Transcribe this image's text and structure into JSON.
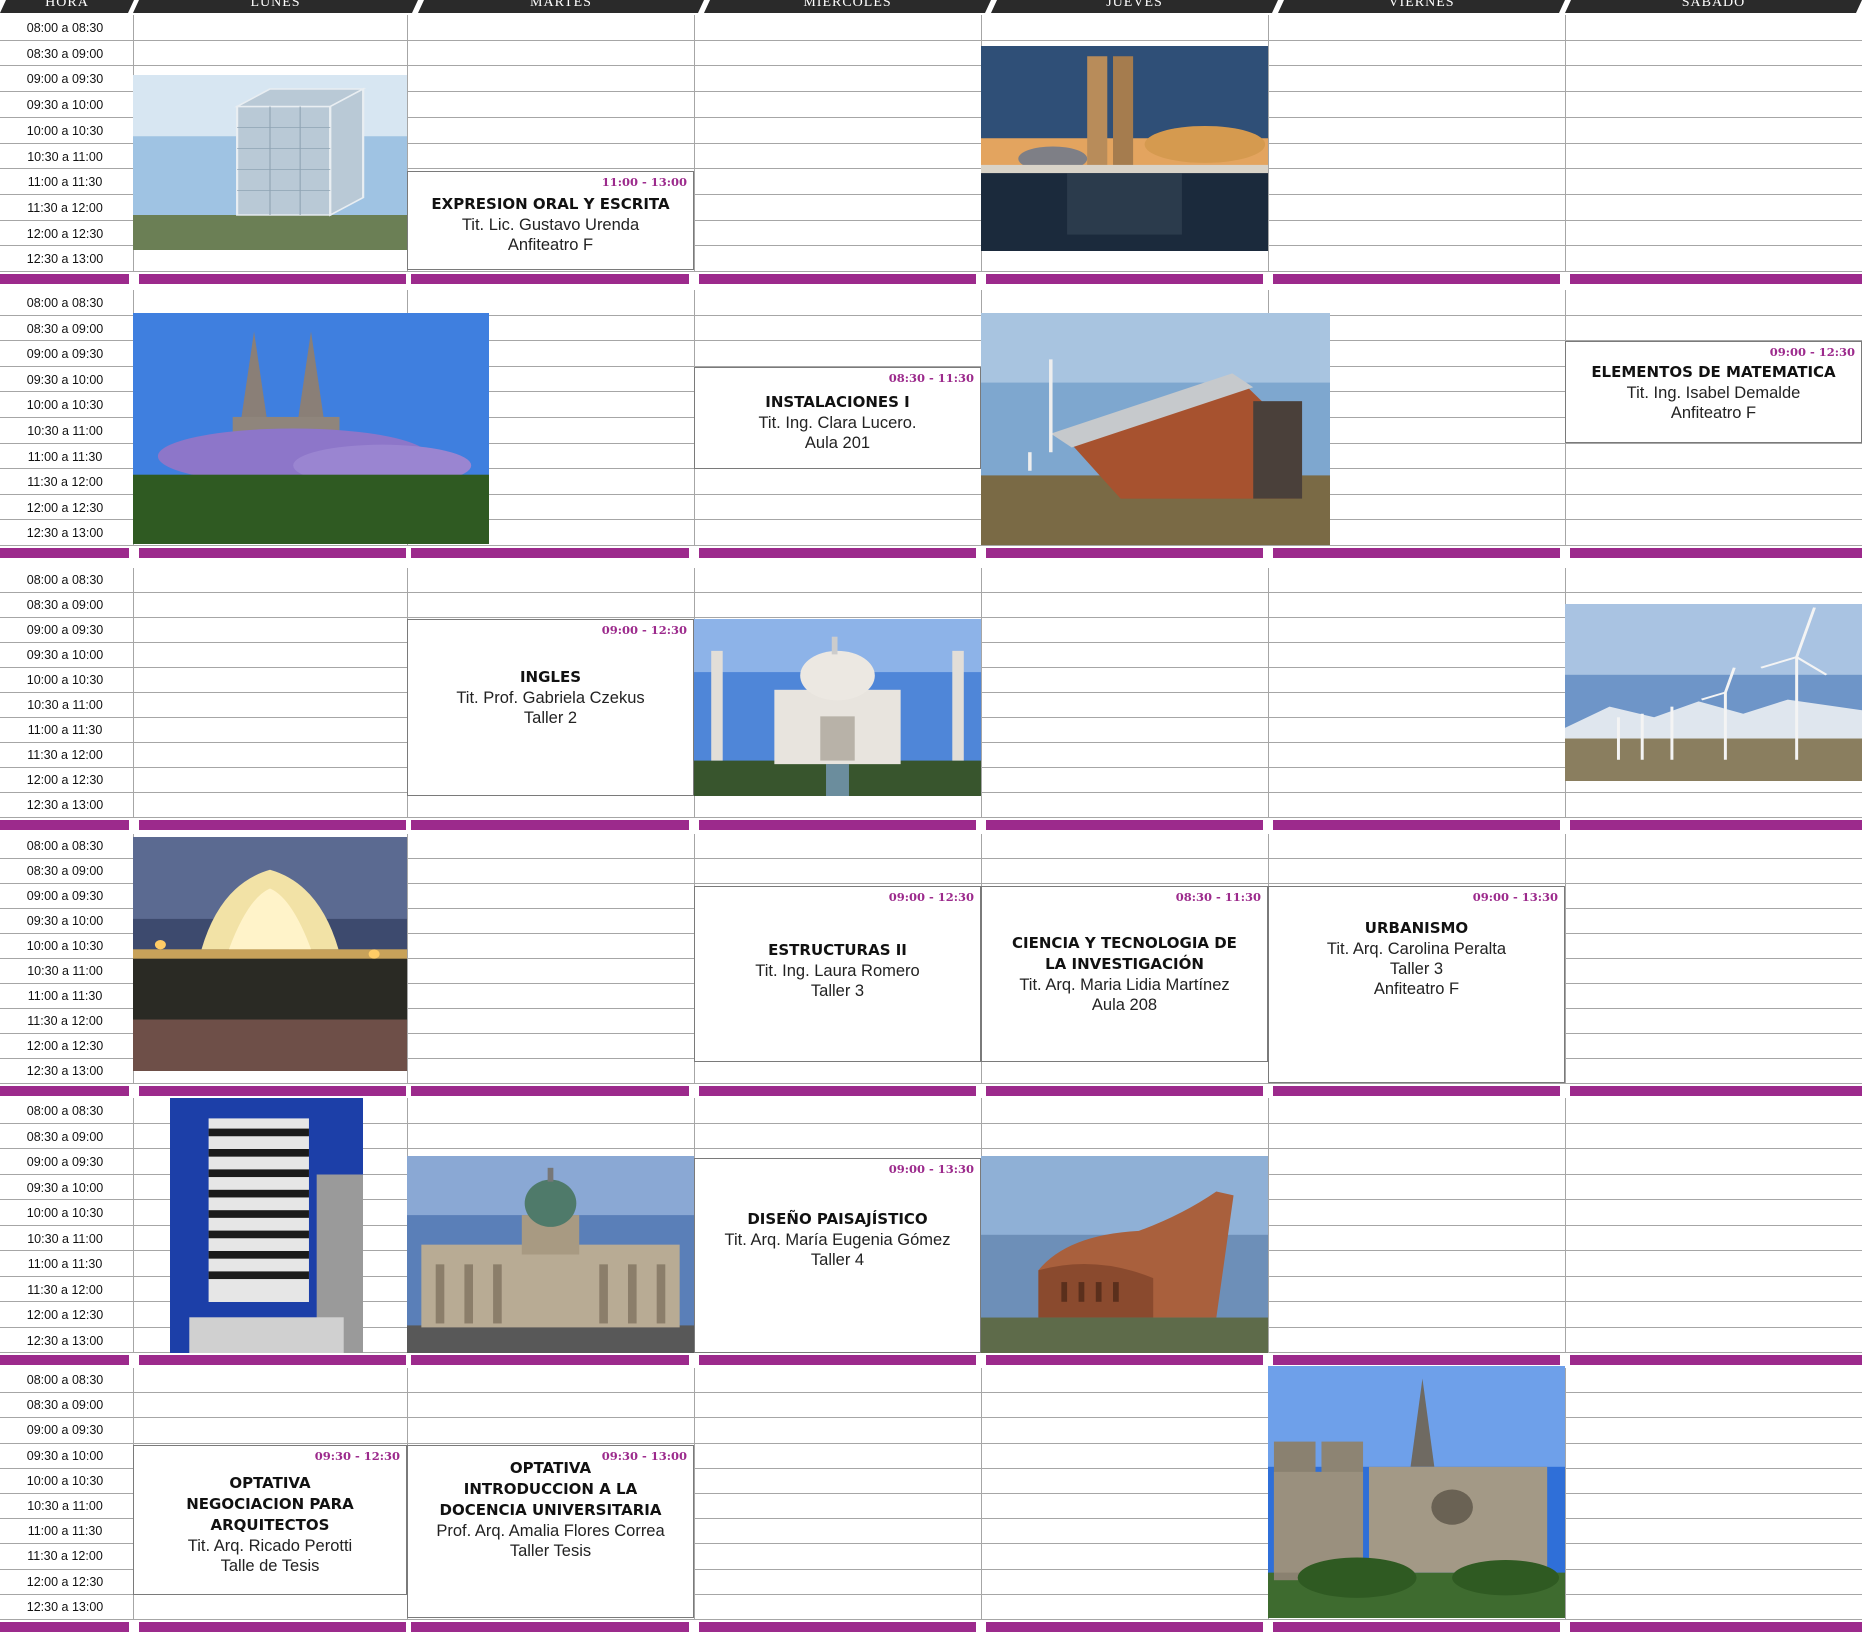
{
  "headers": [
    "HORA",
    "LUNES",
    "MARTES",
    "MIERCOLES",
    "JUEVES",
    "VIERNES",
    "SABADO"
  ],
  "times": [
    "08:00 a 08:30",
    "08:30 a 09:00",
    "09:00 a 09:30",
    "09:30 a 10:00",
    "10:00 a 10:30",
    "10:30 a 11:00",
    "11:00 a 11:30",
    "11:30 a 12:00",
    "12:00 a 12:30",
    "12:30 a 13:00"
  ],
  "colors": {
    "accent": "#9c2a8c",
    "header_bg": "#2a2a2a",
    "grid": "#a6a6a6"
  },
  "courses": [
    {
      "time": "11:00 - 13:00",
      "name": [
        "EXPRESION ORAL Y ESCRITA"
      ],
      "lines": [
        "Tit. Lic. Gustavo Urenda",
        "Anfiteatro F"
      ]
    },
    {
      "time": "08:30 - 11:30",
      "name": [
        "INSTALACIONES I"
      ],
      "lines": [
        "Tit. Ing. Clara Lucero.",
        "Aula 201"
      ]
    },
    {
      "time": "09:00 - 12:30",
      "name": [
        "ELEMENTOS DE MATEMATICA"
      ],
      "lines": [
        "Tit. Ing. Isabel Demalde",
        "Anfiteatro F"
      ]
    },
    {
      "time": "09:00 - 12:30",
      "name": [
        "INGLES"
      ],
      "lines": [
        "Tit. Prof. Gabriela Czekus",
        "Taller 2"
      ]
    },
    {
      "time": "09:00 - 12:30",
      "name": [
        "ESTRUCTURAS II"
      ],
      "lines": [
        "Tit. Ing. Laura Romero",
        "Taller 3"
      ]
    },
    {
      "time": "08:30 - 11:30",
      "name": [
        "CIENCIA Y TECNOLOGIA DE",
        "LA INVESTIGACIÓN"
      ],
      "lines": [
        "Tit. Arq. Maria Lidia Martínez",
        "Aula 208"
      ]
    },
    {
      "time": "09:00 - 13:30",
      "name": [
        "URBANISMO"
      ],
      "lines": [
        "Tit. Arq. Carolina Peralta",
        "Taller 3",
        "Anfiteatro F"
      ]
    },
    {
      "time": "09:00 - 13:30",
      "name": [
        "DISEÑO PAISAJÍSTICO"
      ],
      "lines": [
        "Tit. Arq. María Eugenia Gómez",
        "Taller 4"
      ]
    },
    {
      "time": "09:30 - 12:30",
      "name": [
        "OPTATIVA",
        "NEGOCIACION PARA",
        "ARQUITECTOS"
      ],
      "lines": [
        "Tit. Arq. Ricado Perotti",
        "Talle de Tesis"
      ]
    },
    {
      "time": "09:30 - 13:00",
      "name": [
        "OPTATIVA",
        "INTRODUCCION A LA",
        "DOCENCIA UNIVERSITARIA"
      ],
      "lines": [
        "Prof. Arq. Amalia Flores Correa",
        "Taller Tesis"
      ]
    }
  ],
  "photos": [
    {
      "icon": "glass-cube-building-photo-icon"
    },
    {
      "icon": "congress-towers-photo-icon"
    },
    {
      "icon": "twin-spire-cathedral-photo-icon"
    },
    {
      "icon": "solar-house-photo-icon"
    },
    {
      "icon": "taj-mahal-photo-icon"
    },
    {
      "icon": "wind-turbines-photo-icon"
    },
    {
      "icon": "lotus-temple-photo-icon"
    },
    {
      "icon": "tower-block-photo-icon"
    },
    {
      "icon": "national-congress-dome-photo-icon"
    },
    {
      "icon": "brick-church-photo-icon"
    },
    {
      "icon": "gothic-cathedral-photo-icon"
    }
  ]
}
